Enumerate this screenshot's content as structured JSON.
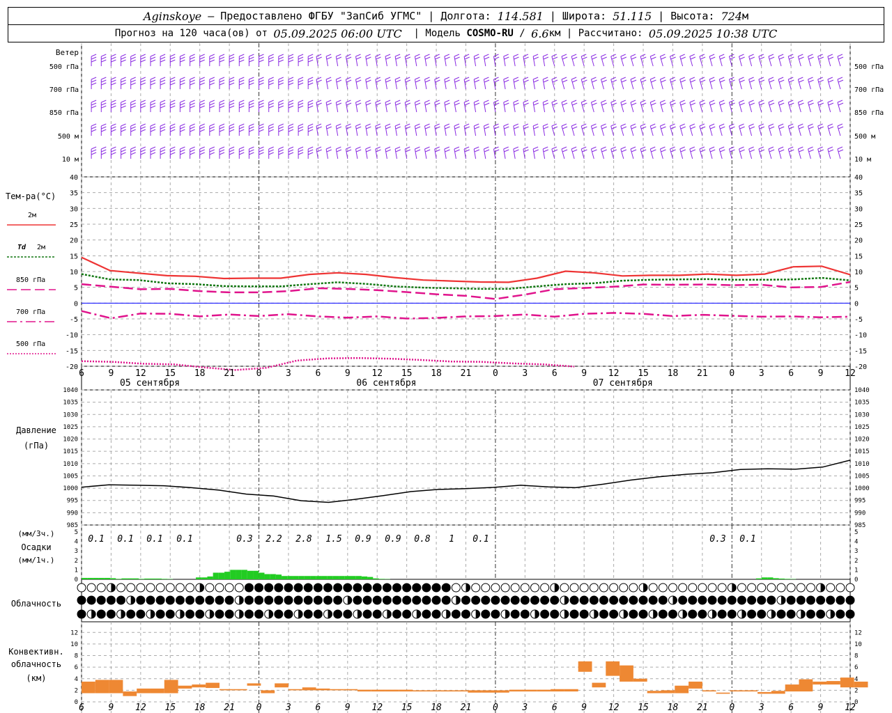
{
  "header": {
    "station": "Aginskoye",
    "provider": " – Предоставлено ФГБУ \"ЗапСиб УГМС\" | Долгота: ",
    "lon": "114.581",
    "lat_label": " | Широта: ",
    "lat": "51.115",
    "alt_label": " | Высота: ",
    "alt": "724",
    "alt_unit": "м",
    "forecast_prefix": "Прогноз на 120 часа(ов) от ",
    "forecast_start": "05.09.2025 06:00 UTC",
    "model_label": "  | Модель ",
    "model": "COSMO-RU",
    "res_sep": " / ",
    "res": "6.6",
    "res_unit": "км",
    "calc_label": " | Рассчитано: ",
    "calc_time": "05.09.2025 10:38 UTC"
  },
  "colors": {
    "wind": "#8a2be2",
    "t2m": "#ee3333",
    "td2m": "#117711",
    "t850": "#e0138c",
    "t700": "#e0138c",
    "t500": "#e0138c",
    "zero": "#0000ff",
    "pressure": "#000000",
    "precip": "#22cc22",
    "convective": "#ee8833",
    "grid": "#aaaaaa"
  },
  "labels": {
    "wind_title": "Ветер",
    "wind_levels": [
      "500 гПа",
      "700 гПа",
      "850 гПа",
      "500 м",
      "10 м"
    ],
    "temp_title": "Тем-ра(°C)",
    "legend_t2m": "2м",
    "legend_td_sym": "Td",
    "legend_td": "2м",
    "legend_850": "850 гПа",
    "legend_700": "700 гПа",
    "legend_500": "500 гПа",
    "pressure_title": "Давление",
    "pressure_unit": "(гПа)",
    "precip_unit_top": "(мм/3ч.)",
    "precip_title": "Осадки",
    "precip_unit_bottom": "(мм/1ч.)",
    "cloud_title": "Облачность",
    "conv_title1": "Конвективн.",
    "conv_title2": "облачность",
    "conv_unit": "(км)"
  },
  "dates": [
    "05 сентября",
    "06 сентября",
    "07 сентября"
  ],
  "hour_ticks": [
    "6",
    "9",
    "12",
    "15",
    "18",
    "21",
    "0",
    "3",
    "6",
    "9",
    "12",
    "15",
    "18",
    "21",
    "0",
    "3",
    "6",
    "9",
    "12",
    "15",
    "18",
    "21",
    "0",
    "3",
    "6",
    "9",
    "12"
  ],
  "chart_data": [
    {
      "type": "line",
      "title": "Тем-ра(°C)",
      "ylim": [
        -20,
        40
      ],
      "yticks": [
        "40",
        "35",
        "30",
        "25",
        "20",
        "15",
        "10",
        "5",
        "0",
        "-5",
        "-10",
        "-15",
        "-20"
      ],
      "x_hours_from_start": [
        0,
        3,
        6,
        9,
        12,
        15,
        18,
        21,
        24,
        27,
        30,
        33,
        36,
        39,
        42,
        45,
        48,
        51,
        54,
        57,
        60,
        63,
        66,
        69,
        72,
        75,
        78
      ],
      "series": [
        {
          "name": "2м",
          "values": [
            14.5,
            10.3,
            9.5,
            8.7,
            8.5,
            7.8,
            7.9,
            7.9,
            9.1,
            9.6,
            9.1,
            8.1,
            7.3,
            7.0,
            6.7,
            6.6,
            7.9,
            10.1,
            9.6,
            8.6,
            8.8,
            8.8,
            9.2,
            8.8,
            9.2,
            11.5,
            11.7,
            9.0
          ]
        },
        {
          "name": "Td 2м",
          "values": [
            9.2,
            7.5,
            7.3,
            6.3,
            6.0,
            5.4,
            5.3,
            5.3,
            6.0,
            6.6,
            6.1,
            5.3,
            4.9,
            4.7,
            4.5,
            4.5,
            5.3,
            6.0,
            6.3,
            7.1,
            7.4,
            7.5,
            7.6,
            7.4,
            7.4,
            7.5,
            8.0,
            7.2
          ]
        },
        {
          "name": "850 гПа",
          "values": [
            6.0,
            5.2,
            4.4,
            4.5,
            3.8,
            3.4,
            3.4,
            3.8,
            4.7,
            4.5,
            4.1,
            3.5,
            2.8,
            2.3,
            1.3,
            2.7,
            4.4,
            4.8,
            5.2,
            5.9,
            5.8,
            5.9,
            5.7,
            5.8,
            5.0,
            5.1,
            6.7
          ]
        },
        {
          "name": "700 гПа",
          "values": [
            -2.5,
            -4.8,
            -3.3,
            -3.4,
            -4.2,
            -3.6,
            -4.1,
            -3.5,
            -4.2,
            -4.6,
            -4.2,
            -4.9,
            -4.7,
            -4.2,
            -4.1,
            -3.6,
            -4.3,
            -3.4,
            -3.1,
            -3.4,
            -4.1,
            -3.7,
            -4.0,
            -4.3,
            -4.2,
            -4.5,
            -4.3
          ]
        },
        {
          "name": "500 гПа",
          "values": [
            -18.4,
            -18.6,
            -19.2,
            -19.4,
            -20.4,
            -21.2,
            -20.5,
            -18.2,
            -17.5,
            -17.4,
            -17.6,
            -18.0,
            -18.5,
            -18.6,
            -19.1,
            -19.4,
            -20.1
          ]
        }
      ]
    },
    {
      "type": "line",
      "title": "Давление",
      "ylabel": "(гПа)",
      "ylim": [
        985,
        1040
      ],
      "yticks": [
        "1040",
        "1035",
        "1030",
        "1025",
        "1020",
        "1015",
        "1010",
        "1005",
        "1000",
        "995",
        "990",
        "985"
      ],
      "x_hours_from_start": [
        0,
        3,
        6,
        9,
        12,
        15,
        18,
        21,
        24,
        27,
        30,
        33,
        36,
        39,
        42,
        45,
        48,
        51,
        54,
        57,
        60,
        63,
        66,
        69,
        72,
        75,
        78
      ],
      "values": [
        1000.4,
        1001.4,
        1001.2,
        1001.0,
        1000.2,
        999.2,
        997.6,
        996.8,
        994.9,
        994.2,
        995.5,
        997.0,
        998.6,
        999.5,
        999.8,
        1000.3,
        1001.2,
        1000.5,
        1000.2,
        1001.6,
        1003.3,
        1004.6,
        1005.6,
        1006.3,
        1007.6,
        1007.9,
        1007.7,
        1008.6,
        1011.4
      ]
    },
    {
      "type": "bar",
      "title": "Осадки",
      "ylim": [
        0,
        5
      ],
      "yticks": [
        "5",
        "4",
        "3",
        "2",
        "1",
        "0"
      ],
      "labels_3h": [
        "0.1",
        "0.1",
        "0.1",
        "0.1",
        "0.3",
        "2.2",
        "2.8",
        "1.5",
        "0.9",
        "0.9",
        "0.8",
        "1",
        "0.1",
        "0.3",
        "0.1"
      ],
      "hourly_mm": [
        0.15,
        0.15,
        0.15,
        0.15,
        0.15,
        0.12,
        0.05,
        0.1,
        0.1,
        0.1,
        0.05,
        0.08,
        0.08,
        0.08,
        0.05,
        0.03,
        0,
        0,
        0,
        0,
        0.2,
        0.2,
        0.3,
        0.7,
        0.7,
        0.8,
        1.0,
        1.0,
        1.0,
        0.9,
        0.9,
        0.7,
        0.55,
        0.55,
        0.5,
        0.35,
        0.35,
        0.35,
        0.35,
        0.35,
        0.35,
        0.35,
        0.35,
        0.35,
        0.35,
        0.35,
        0.35,
        0.35,
        0.35,
        0.3,
        0.25,
        0.1,
        0.05,
        0.03,
        0,
        0,
        0,
        0,
        0,
        0,
        0,
        0,
        0,
        0,
        0,
        0,
        0,
        0,
        0,
        0,
        0,
        0,
        0,
        0,
        0,
        0,
        0,
        0,
        0,
        0,
        0,
        0,
        0,
        0,
        0,
        0,
        0,
        0,
        0,
        0,
        0,
        0,
        0,
        0,
        0,
        0,
        0,
        0,
        0,
        0,
        0,
        0,
        0,
        0,
        0,
        0,
        0,
        0,
        0,
        0,
        0,
        0,
        0,
        0,
        0,
        0,
        0,
        0,
        0.1,
        0.2,
        0.2,
        0.12,
        0.08,
        0.05,
        0.03,
        0,
        0,
        0,
        0,
        0,
        0,
        0,
        0,
        0,
        0,
        0,
        0,
        0,
        0,
        0,
        0,
        0
      ]
    },
    {
      "type": "bar",
      "title": "Конвективн. облачность",
      "ylabel": "(км)",
      "ylim": [
        0,
        13
      ],
      "yticks": [
        "12",
        "10",
        "8",
        "6",
        "4",
        "2",
        "0"
      ],
      "bars_km": [
        [
          1,
          1.5,
          3.5
        ],
        [
          2,
          1.5,
          3.8
        ],
        [
          3,
          1.5,
          3.8
        ],
        [
          4,
          1,
          1.8
        ],
        [
          5,
          1.5,
          2.3
        ],
        [
          6,
          1.5,
          2.3
        ],
        [
          7,
          1.5,
          3.8
        ],
        [
          8,
          2.3,
          2.8
        ],
        [
          9,
          2.5,
          3.0
        ],
        [
          10,
          2.4,
          3.3
        ],
        [
          11,
          2,
          2.2
        ],
        [
          12,
          2,
          2.2
        ],
        [
          13,
          2.8,
          3.2
        ],
        [
          14,
          1.5,
          2.0
        ],
        [
          15,
          2.5,
          3.2
        ],
        [
          16,
          2,
          2.2
        ],
        [
          17,
          2,
          2.5
        ],
        [
          18,
          2,
          2.3
        ],
        [
          19,
          2,
          2.2
        ],
        [
          20,
          2,
          2.2
        ],
        [
          21,
          1.8,
          2.1
        ],
        [
          22,
          1.8,
          2.1
        ],
        [
          23,
          1.8,
          2.1
        ],
        [
          24,
          1.8,
          2.1
        ],
        [
          25,
          1.8,
          2.0
        ],
        [
          26,
          1.8,
          2.0
        ],
        [
          27,
          1.8,
          2.0
        ],
        [
          28,
          1.8,
          2.0
        ],
        [
          29,
          1.6,
          2.0
        ],
        [
          30,
          1.6,
          2.0
        ],
        [
          31,
          1.6,
          2.0
        ],
        [
          32,
          1.8,
          2.1
        ],
        [
          33,
          1.8,
          2.1
        ],
        [
          34,
          1.8,
          2.1
        ],
        [
          35,
          1.8,
          2.2
        ],
        [
          36,
          1.8,
          2.2
        ],
        [
          37,
          5.2,
          7.0
        ],
        [
          38,
          2.5,
          3.3
        ],
        [
          39,
          4.5,
          7.0
        ],
        [
          40,
          3.5,
          6.3
        ],
        [
          41,
          3.5,
          4.0
        ],
        [
          42,
          1.5,
          1.9
        ],
        [
          43,
          1.5,
          2.0
        ],
        [
          44,
          1.5,
          2.8
        ],
        [
          45,
          2.3,
          3.5
        ],
        [
          46,
          1.8,
          2.0
        ],
        [
          47,
          1.4,
          1.6
        ],
        [
          48,
          1.8,
          2.0
        ],
        [
          49,
          1.8,
          2.0
        ],
        [
          50,
          1.4,
          1.7
        ],
        [
          51,
          1.4,
          1.9
        ],
        [
          52,
          1.8,
          3.0
        ],
        [
          53,
          1.8,
          3.9
        ],
        [
          54,
          3.0,
          3.5
        ],
        [
          55,
          3.0,
          3.6
        ],
        [
          56,
          2.5,
          4.2
        ],
        [
          57,
          2.5,
          3.5
        ]
      ]
    }
  ]
}
